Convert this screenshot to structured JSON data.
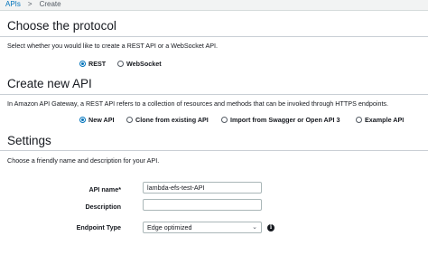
{
  "breadcrumb": {
    "parent": "APIs",
    "separator": ">",
    "current": "Create"
  },
  "protocol": {
    "title": "Choose the protocol",
    "description": "Select whether you would like to create a REST API or a WebSocket API.",
    "options": [
      {
        "label": "REST",
        "checked": true
      },
      {
        "label": "WebSocket",
        "checked": false
      }
    ]
  },
  "create_api": {
    "title": "Create new API",
    "description": "In Amazon API Gateway, a REST API refers to a collection of resources and methods that can be invoked through HTTPS endpoints.",
    "options": [
      {
        "label": "New API",
        "checked": true
      },
      {
        "label": "Clone from existing API",
        "checked": false
      },
      {
        "label": "Import from Swagger or Open API 3",
        "checked": false
      },
      {
        "label": "Example API",
        "checked": false
      }
    ]
  },
  "settings": {
    "title": "Settings",
    "description": "Choose a friendly name and description for your API.",
    "api_name_label": "API name*",
    "api_name_value": "lambda-efs-test-API",
    "description_label": "Description",
    "description_value": "",
    "endpoint_label": "Endpoint Type",
    "endpoint_value": "Edge optimized",
    "chevron_glyph": "⌄",
    "info_glyph": "i"
  }
}
